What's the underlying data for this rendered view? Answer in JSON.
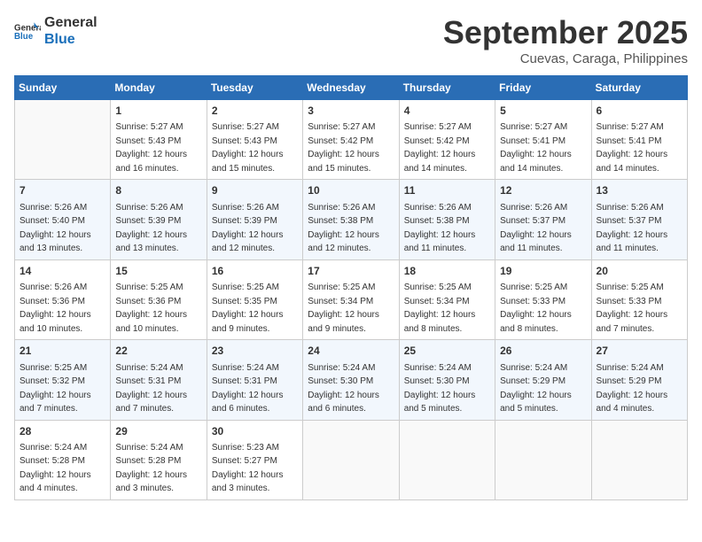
{
  "logo": {
    "general": "General",
    "blue": "Blue"
  },
  "title": "September 2025",
  "location": "Cuevas, Caraga, Philippines",
  "days_of_week": [
    "Sunday",
    "Monday",
    "Tuesday",
    "Wednesday",
    "Thursday",
    "Friday",
    "Saturday"
  ],
  "weeks": [
    [
      {
        "num": "",
        "empty": true
      },
      {
        "num": "1",
        "sunrise": "5:27 AM",
        "sunset": "5:43 PM",
        "daylight": "12 hours and 16 minutes."
      },
      {
        "num": "2",
        "sunrise": "5:27 AM",
        "sunset": "5:43 PM",
        "daylight": "12 hours and 15 minutes."
      },
      {
        "num": "3",
        "sunrise": "5:27 AM",
        "sunset": "5:42 PM",
        "daylight": "12 hours and 15 minutes."
      },
      {
        "num": "4",
        "sunrise": "5:27 AM",
        "sunset": "5:42 PM",
        "daylight": "12 hours and 14 minutes."
      },
      {
        "num": "5",
        "sunrise": "5:27 AM",
        "sunset": "5:41 PM",
        "daylight": "12 hours and 14 minutes."
      },
      {
        "num": "6",
        "sunrise": "5:27 AM",
        "sunset": "5:41 PM",
        "daylight": "12 hours and 14 minutes."
      }
    ],
    [
      {
        "num": "7",
        "sunrise": "5:26 AM",
        "sunset": "5:40 PM",
        "daylight": "12 hours and 13 minutes."
      },
      {
        "num": "8",
        "sunrise": "5:26 AM",
        "sunset": "5:39 PM",
        "daylight": "12 hours and 13 minutes."
      },
      {
        "num": "9",
        "sunrise": "5:26 AM",
        "sunset": "5:39 PM",
        "daylight": "12 hours and 12 minutes."
      },
      {
        "num": "10",
        "sunrise": "5:26 AM",
        "sunset": "5:38 PM",
        "daylight": "12 hours and 12 minutes."
      },
      {
        "num": "11",
        "sunrise": "5:26 AM",
        "sunset": "5:38 PM",
        "daylight": "12 hours and 11 minutes."
      },
      {
        "num": "12",
        "sunrise": "5:26 AM",
        "sunset": "5:37 PM",
        "daylight": "12 hours and 11 minutes."
      },
      {
        "num": "13",
        "sunrise": "5:26 AM",
        "sunset": "5:37 PM",
        "daylight": "12 hours and 11 minutes."
      }
    ],
    [
      {
        "num": "14",
        "sunrise": "5:26 AM",
        "sunset": "5:36 PM",
        "daylight": "12 hours and 10 minutes."
      },
      {
        "num": "15",
        "sunrise": "5:25 AM",
        "sunset": "5:36 PM",
        "daylight": "12 hours and 10 minutes."
      },
      {
        "num": "16",
        "sunrise": "5:25 AM",
        "sunset": "5:35 PM",
        "daylight": "12 hours and 9 minutes."
      },
      {
        "num": "17",
        "sunrise": "5:25 AM",
        "sunset": "5:34 PM",
        "daylight": "12 hours and 9 minutes."
      },
      {
        "num": "18",
        "sunrise": "5:25 AM",
        "sunset": "5:34 PM",
        "daylight": "12 hours and 8 minutes."
      },
      {
        "num": "19",
        "sunrise": "5:25 AM",
        "sunset": "5:33 PM",
        "daylight": "12 hours and 8 minutes."
      },
      {
        "num": "20",
        "sunrise": "5:25 AM",
        "sunset": "5:33 PM",
        "daylight": "12 hours and 7 minutes."
      }
    ],
    [
      {
        "num": "21",
        "sunrise": "5:25 AM",
        "sunset": "5:32 PM",
        "daylight": "12 hours and 7 minutes."
      },
      {
        "num": "22",
        "sunrise": "5:24 AM",
        "sunset": "5:31 PM",
        "daylight": "12 hours and 7 minutes."
      },
      {
        "num": "23",
        "sunrise": "5:24 AM",
        "sunset": "5:31 PM",
        "daylight": "12 hours and 6 minutes."
      },
      {
        "num": "24",
        "sunrise": "5:24 AM",
        "sunset": "5:30 PM",
        "daylight": "12 hours and 6 minutes."
      },
      {
        "num": "25",
        "sunrise": "5:24 AM",
        "sunset": "5:30 PM",
        "daylight": "12 hours and 5 minutes."
      },
      {
        "num": "26",
        "sunrise": "5:24 AM",
        "sunset": "5:29 PM",
        "daylight": "12 hours and 5 minutes."
      },
      {
        "num": "27",
        "sunrise": "5:24 AM",
        "sunset": "5:29 PM",
        "daylight": "12 hours and 4 minutes."
      }
    ],
    [
      {
        "num": "28",
        "sunrise": "5:24 AM",
        "sunset": "5:28 PM",
        "daylight": "12 hours and 4 minutes."
      },
      {
        "num": "29",
        "sunrise": "5:24 AM",
        "sunset": "5:28 PM",
        "daylight": "12 hours and 3 minutes."
      },
      {
        "num": "30",
        "sunrise": "5:23 AM",
        "sunset": "5:27 PM",
        "daylight": "12 hours and 3 minutes."
      },
      {
        "num": "",
        "empty": true
      },
      {
        "num": "",
        "empty": true
      },
      {
        "num": "",
        "empty": true
      },
      {
        "num": "",
        "empty": true
      }
    ]
  ]
}
